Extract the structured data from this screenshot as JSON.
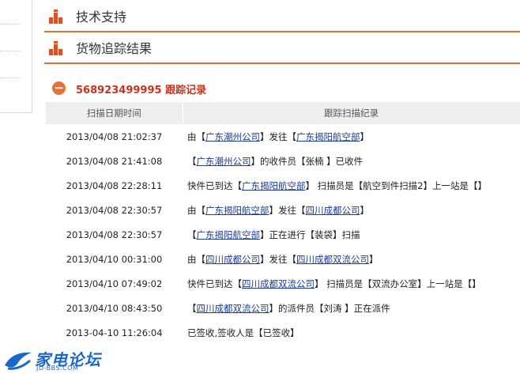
{
  "sections": [
    {
      "title": "技术支持"
    },
    {
      "title": "货物追踪结果"
    }
  ],
  "tracking": {
    "title": "568923499995 跟踪记录",
    "columns": [
      "扫描日期时间",
      "跟踪扫描纪录"
    ],
    "rows": [
      {
        "date": "2013/04/08 21:02:37",
        "parts": [
          {
            "t": "由【"
          },
          {
            "t": "广东潮州公司",
            "link": true
          },
          {
            "t": "】发往【"
          },
          {
            "t": "广东揭阳航空部",
            "link": true
          },
          {
            "t": "】"
          }
        ]
      },
      {
        "date": "2013/04/08 21:41:08",
        "parts": [
          {
            "t": "【"
          },
          {
            "t": "广东潮州公司",
            "link": true
          },
          {
            "t": "】的收件员【张楠 】已收件"
          }
        ]
      },
      {
        "date": "2013/04/08 22:28:11",
        "parts": [
          {
            "t": "快件已到达【"
          },
          {
            "t": "广东揭阳航空部",
            "link": true
          },
          {
            "t": "】 扫描员是【航空到件扫描2】上一站是【】"
          }
        ]
      },
      {
        "date": "2013/04/08 22:30:57",
        "parts": [
          {
            "t": "由【"
          },
          {
            "t": "广东揭阳航空部",
            "link": true
          },
          {
            "t": "】发往【"
          },
          {
            "t": "四川成都公司",
            "link": true
          },
          {
            "t": "】"
          }
        ]
      },
      {
        "date": "2013/04/08 22:30:57",
        "parts": [
          {
            "t": "【"
          },
          {
            "t": "广东揭阳航空部",
            "link": true
          },
          {
            "t": "】正在进行【装袋】扫描"
          }
        ]
      },
      {
        "date": "2013/04/10 00:31:00",
        "parts": [
          {
            "t": "由【"
          },
          {
            "t": "四川成都公司",
            "link": true
          },
          {
            "t": "】发往【"
          },
          {
            "t": "四川成都双流公司",
            "link": true
          },
          {
            "t": "】"
          }
        ]
      },
      {
        "date": "2013/04/10 07:49:02",
        "parts": [
          {
            "t": "快件已到达【"
          },
          {
            "t": "四川成都双流公司",
            "link": true
          },
          {
            "t": "】 扫描员是【双流办公室】上一站是【】"
          }
        ]
      },
      {
        "date": "2013/04/10 08:43:50",
        "parts": [
          {
            "t": "【"
          },
          {
            "t": "四川成都双流公司",
            "link": true
          },
          {
            "t": "】的派件员【刘涛 】正在派件"
          }
        ]
      },
      {
        "date": "2013-04-10 11:26:04",
        "parts": [
          {
            "t": "已签收,签收人是【已签收】"
          }
        ]
      }
    ]
  },
  "watermark": {
    "name": "家电论坛",
    "url": "JD-BBS.COM"
  },
  "colors": {
    "accent": "#d8743a",
    "title_red": "#c8321f",
    "link": "#1a3b9a",
    "header_bg": "#eeeeee"
  }
}
